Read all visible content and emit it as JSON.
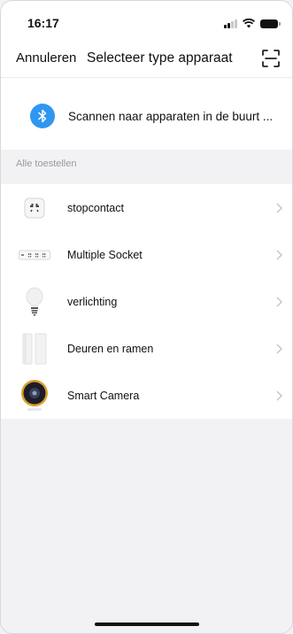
{
  "status_bar": {
    "time": "16:17"
  },
  "navbar": {
    "cancel_label": "Annuleren",
    "title": "Selecteer type apparaat"
  },
  "bluetooth": {
    "label": "Scannen naar apparaten in de buurt ..."
  },
  "section": {
    "header": "Alle toestellen"
  },
  "devices": [
    {
      "label": "stopcontact",
      "icon": "socket-icon"
    },
    {
      "label": "Multiple Socket",
      "icon": "power-strip-icon"
    },
    {
      "label": "verlichting",
      "icon": "light-bulb-icon"
    },
    {
      "label": "Deuren en ramen",
      "icon": "door-window-sensor-icon"
    },
    {
      "label": "Smart Camera",
      "icon": "camera-icon"
    }
  ],
  "colors": {
    "bluetooth_accent": "#2f96f2",
    "camera_ring": "#d9a02a",
    "background": "#f2f2f4"
  }
}
